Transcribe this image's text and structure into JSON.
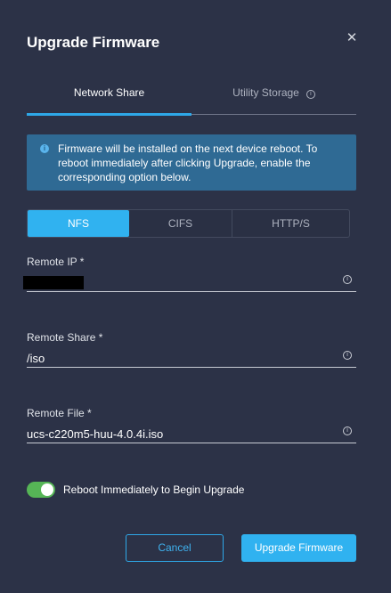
{
  "dialog": {
    "title": "Upgrade Firmware",
    "close_icon": "close-icon"
  },
  "tabs": [
    {
      "label": "Network Share",
      "active": true
    },
    {
      "label": "Utility Storage",
      "active": false,
      "icon": "info-icon"
    }
  ],
  "banner": {
    "icon": "info-icon",
    "message": "Firmware will be installed on the next device reboot. To reboot immediately after clicking Upgrade, enable the corresponding option below."
  },
  "protocols": [
    {
      "label": "NFS",
      "active": true
    },
    {
      "label": "CIFS",
      "active": false
    },
    {
      "label": "HTTP/S",
      "active": false
    }
  ],
  "fields": {
    "remote_ip": {
      "label": "Remote IP *",
      "value": "",
      "redacted": true,
      "icon": "info-icon"
    },
    "remote_share": {
      "label": "Remote Share *",
      "value": "/iso",
      "icon": "info-icon"
    },
    "remote_file": {
      "label": "Remote File *",
      "value": "ucs-c220m5-huu-4.0.4i.iso",
      "icon": "info-icon"
    }
  },
  "reboot_toggle": {
    "label": "Reboot Immediately to Begin Upgrade",
    "on": true
  },
  "buttons": {
    "cancel": "Cancel",
    "upgrade": "Upgrade Firmware"
  },
  "colors": {
    "background": "#2c3247",
    "accent": "#30b2f0",
    "banner": "#2f6a94",
    "toggle_on": "#56b556"
  }
}
